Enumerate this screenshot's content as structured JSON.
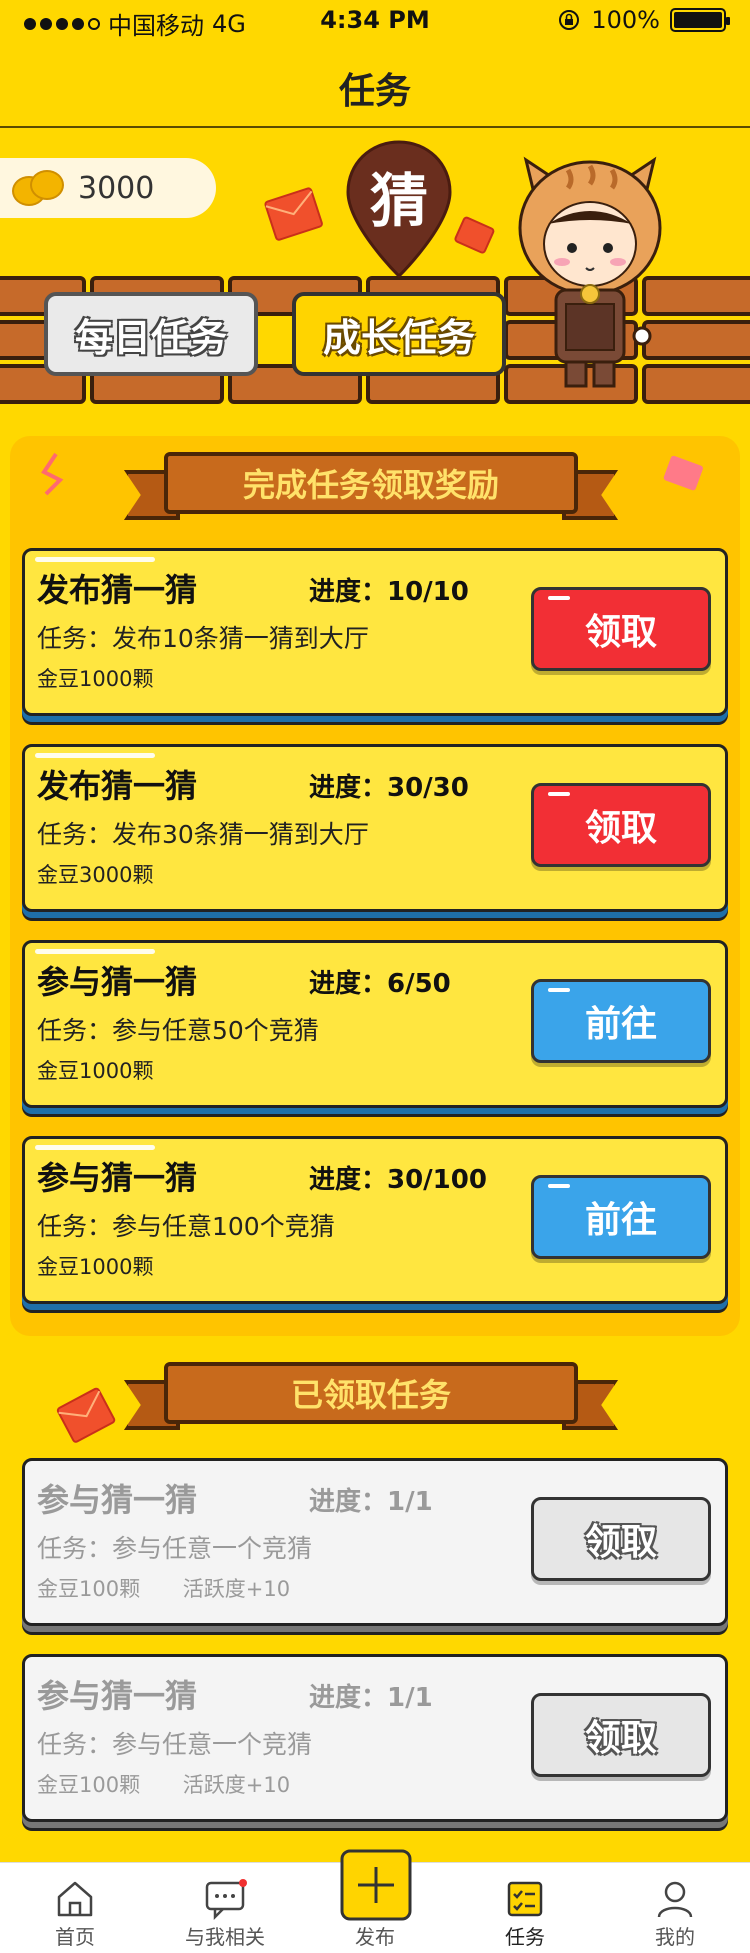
{
  "status_bar": {
    "carrier": "中国移动",
    "network": "4G",
    "time": "4:34 PM",
    "battery": "100%"
  },
  "nav": {
    "title": "任务"
  },
  "banner": {
    "coins": "3000",
    "badge": "猜",
    "tab_daily": "每日任务",
    "tab_growth": "成长任务"
  },
  "section_reward": {
    "title": "完成任务领取奖励"
  },
  "tasks": [
    {
      "title": "发布猜一猜",
      "progress": "进度：10/10",
      "desc": "任务：发布10条猜一猜到大厅",
      "reward": "金豆1000颗",
      "button": "领取"
    },
    {
      "title": "发布猜一猜",
      "progress": "进度：30/30",
      "desc": "任务：发布30条猜一猜到大厅",
      "reward": "金豆3000颗",
      "button": "领取"
    },
    {
      "title": "参与猜一猜",
      "progress": "进度：6/50",
      "desc": "任务：参与任意50个竞猜",
      "reward": "金豆1000颗",
      "button": "前往"
    },
    {
      "title": "参与猜一猜",
      "progress": "进度：30/100",
      "desc": "任务：参与任意100个竞猜",
      "reward": "金豆1000颗",
      "button": "前往"
    }
  ],
  "section_claimed": {
    "title": "已领取任务"
  },
  "claimed": [
    {
      "title": "参与猜一猜",
      "progress": "进度：1/1",
      "desc": "任务：参与任意一个竞猜",
      "reward": "金豆100颗",
      "activity": "活跃度+10",
      "button": "领取"
    },
    {
      "title": "参与猜一猜",
      "progress": "进度：1/1",
      "desc": "任务：参与任意一个竞猜",
      "reward": "金豆100颗",
      "activity": "活跃度+10",
      "button": "领取"
    }
  ],
  "tabbar": [
    {
      "label": "首页",
      "icon": "home-icon"
    },
    {
      "label": "与我相关",
      "icon": "message-icon"
    },
    {
      "label": "发布",
      "icon": "plus-icon"
    },
    {
      "label": "任务",
      "icon": "task-list-icon"
    },
    {
      "label": "我的",
      "icon": "user-icon"
    }
  ],
  "colors": {
    "background": "#ffd800",
    "claim_button": "#f22f35",
    "go_button": "#3aa4ea",
    "ribbon": "#c86a1c"
  }
}
